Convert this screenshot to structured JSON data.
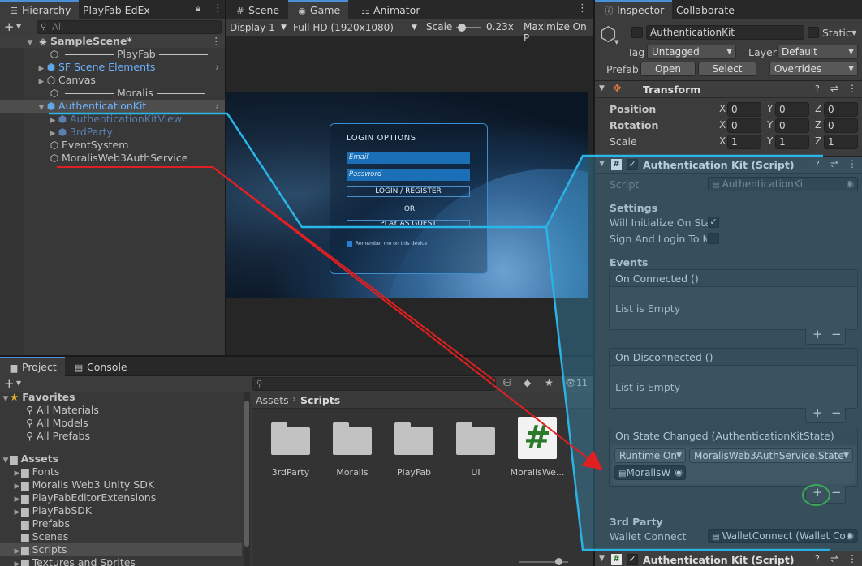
{
  "hierarchy": {
    "tabs": [
      "Hierarchy",
      "PlayFab EdEx"
    ],
    "search_placeholder": "All",
    "scene_name": "SampleScene*",
    "items": [
      {
        "label": "PlayFab",
        "type": "separator"
      },
      {
        "label": "SF Scene Elements",
        "type": "prefab"
      },
      {
        "label": "Canvas",
        "type": "object"
      },
      {
        "label": "Moralis",
        "type": "separator"
      },
      {
        "label": "AuthenticationKit",
        "type": "prefab",
        "selected": true
      },
      {
        "label": "AuthenticationKitView",
        "type": "child-dim"
      },
      {
        "label": "3rdParty",
        "type": "child-dim"
      },
      {
        "label": "EventSystem",
        "type": "object"
      },
      {
        "label": "MoralisWeb3AuthService",
        "type": "object"
      }
    ]
  },
  "game_view": {
    "tabs": [
      "Scene",
      "Game",
      "Animator"
    ],
    "display": "Display 1",
    "resolution": "Full HD (1920x1080)",
    "scale_label": "Scale",
    "scale_value": "0.23x",
    "maximize": "Maximize On P",
    "login": {
      "title": "LOGIN OPTIONS",
      "email_placeholder": "Email",
      "password_placeholder": "Password",
      "login_register": "LOGIN / REGISTER",
      "or": "OR",
      "play_as_guest": "PLAY AS GUEST",
      "remember": "Remember me on this device"
    }
  },
  "project": {
    "tabs": [
      "Project",
      "Console"
    ],
    "favorites_label": "Favorites",
    "favorites": [
      "All Materials",
      "All Models",
      "All Prefabs"
    ],
    "assets_label": "Assets",
    "assets": [
      "Fonts",
      "Moralis Web3 Unity SDK",
      "PlayFabEditorExtensions",
      "PlayFabSDK",
      "Prefabs",
      "Scenes",
      "Scripts",
      "Textures and Sprites"
    ],
    "breadcrumb": [
      "Assets",
      "Scripts"
    ],
    "files": [
      "3rdParty",
      "Moralis",
      "PlayFab",
      "UI",
      "MoralisWe..."
    ],
    "hidden_count": "11"
  },
  "inspector": {
    "tabs": [
      "Inspector",
      "Collaborate"
    ],
    "object_name": "AuthenticationKit",
    "static_label": "Static",
    "tag_label": "Tag",
    "tag_value": "Untagged",
    "layer_label": "Layer",
    "layer_value": "Default",
    "prefab_label": "Prefab",
    "open_label": "Open",
    "select_label": "Select",
    "overrides_label": "Overrides",
    "transform": {
      "title": "Transform",
      "position_label": "Position",
      "rotation_label": "Rotation",
      "scale_label": "Scale",
      "position": [
        "0",
        "0",
        "0"
      ],
      "rotation": [
        "0",
        "0",
        "0"
      ],
      "scale": [
        "1",
        "1",
        "1"
      ]
    },
    "script_component": {
      "title": "Authentication Kit (Script)",
      "script_label": "Script",
      "script_value": "AuthenticationKit",
      "settings_label": "Settings",
      "will_initialize": "Will Initialize On Start",
      "sign_and_login": "Sign And Login To Mc",
      "events_label": "Events",
      "on_connected": "On Connected ()",
      "on_disconnected": "On Disconnected ()",
      "list_empty": "List is Empty",
      "on_state_changed": "On State Changed (AuthenticationKitState)",
      "runtime_option": "Runtime On",
      "method_option": "MoralisWeb3AuthService.State",
      "target_object": "MoralisW",
      "third_party_label": "3rd Party",
      "wallet_connect_label": "Wallet Connect",
      "wallet_connect_value": "WalletConnect (Wallet Con"
    },
    "second_component_title": "Authentication Kit (Script)"
  }
}
